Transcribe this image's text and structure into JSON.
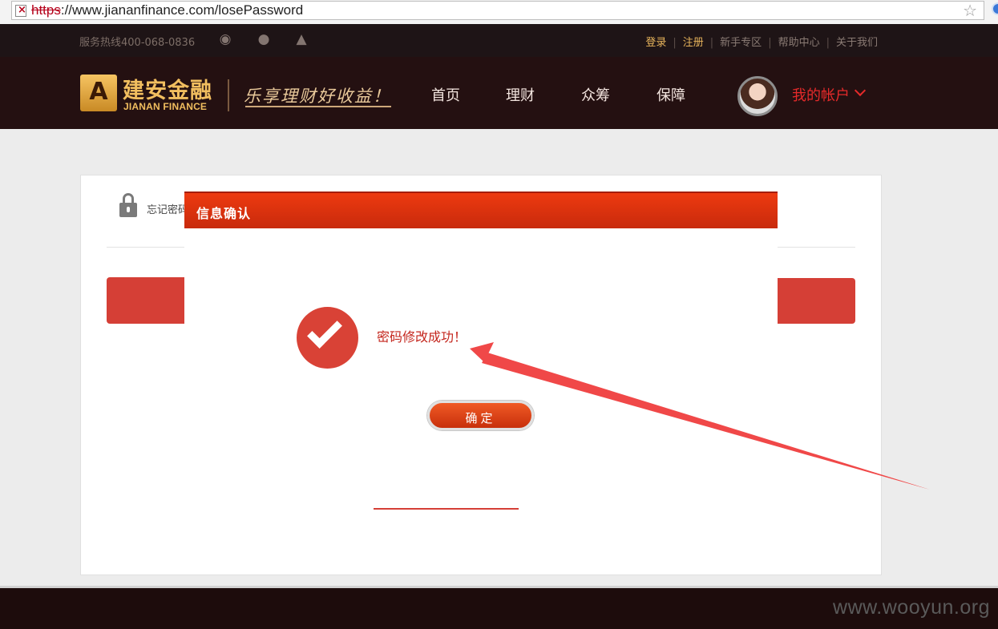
{
  "browser": {
    "url_scheme": "https",
    "url_rest": "://www.jiananfinance.com/losePassword",
    "error_mark": "×"
  },
  "topbar": {
    "hotline": "服务热线400-068-0836",
    "links": [
      "登录",
      "注册",
      "新手专区",
      "帮助中心",
      "关于我们"
    ]
  },
  "header": {
    "logo_cn": "建安金融",
    "logo_en": "JIANAN FINANCE",
    "slogan": "乐享理财好收益！",
    "nav": [
      "首页",
      "理财",
      "众筹",
      "保障"
    ],
    "account_label": "我的帐户"
  },
  "page": {
    "section_label": "忘记密码"
  },
  "modal": {
    "title": "信息确认",
    "message": "密码修改成功！",
    "ok_label": "确定"
  },
  "watermark": "www.wooyun.org",
  "colors": {
    "brand_red": "#d53f36",
    "header_bg": "#241011",
    "gold": "#f1be5f",
    "annotation_arrow": "#f04848"
  }
}
